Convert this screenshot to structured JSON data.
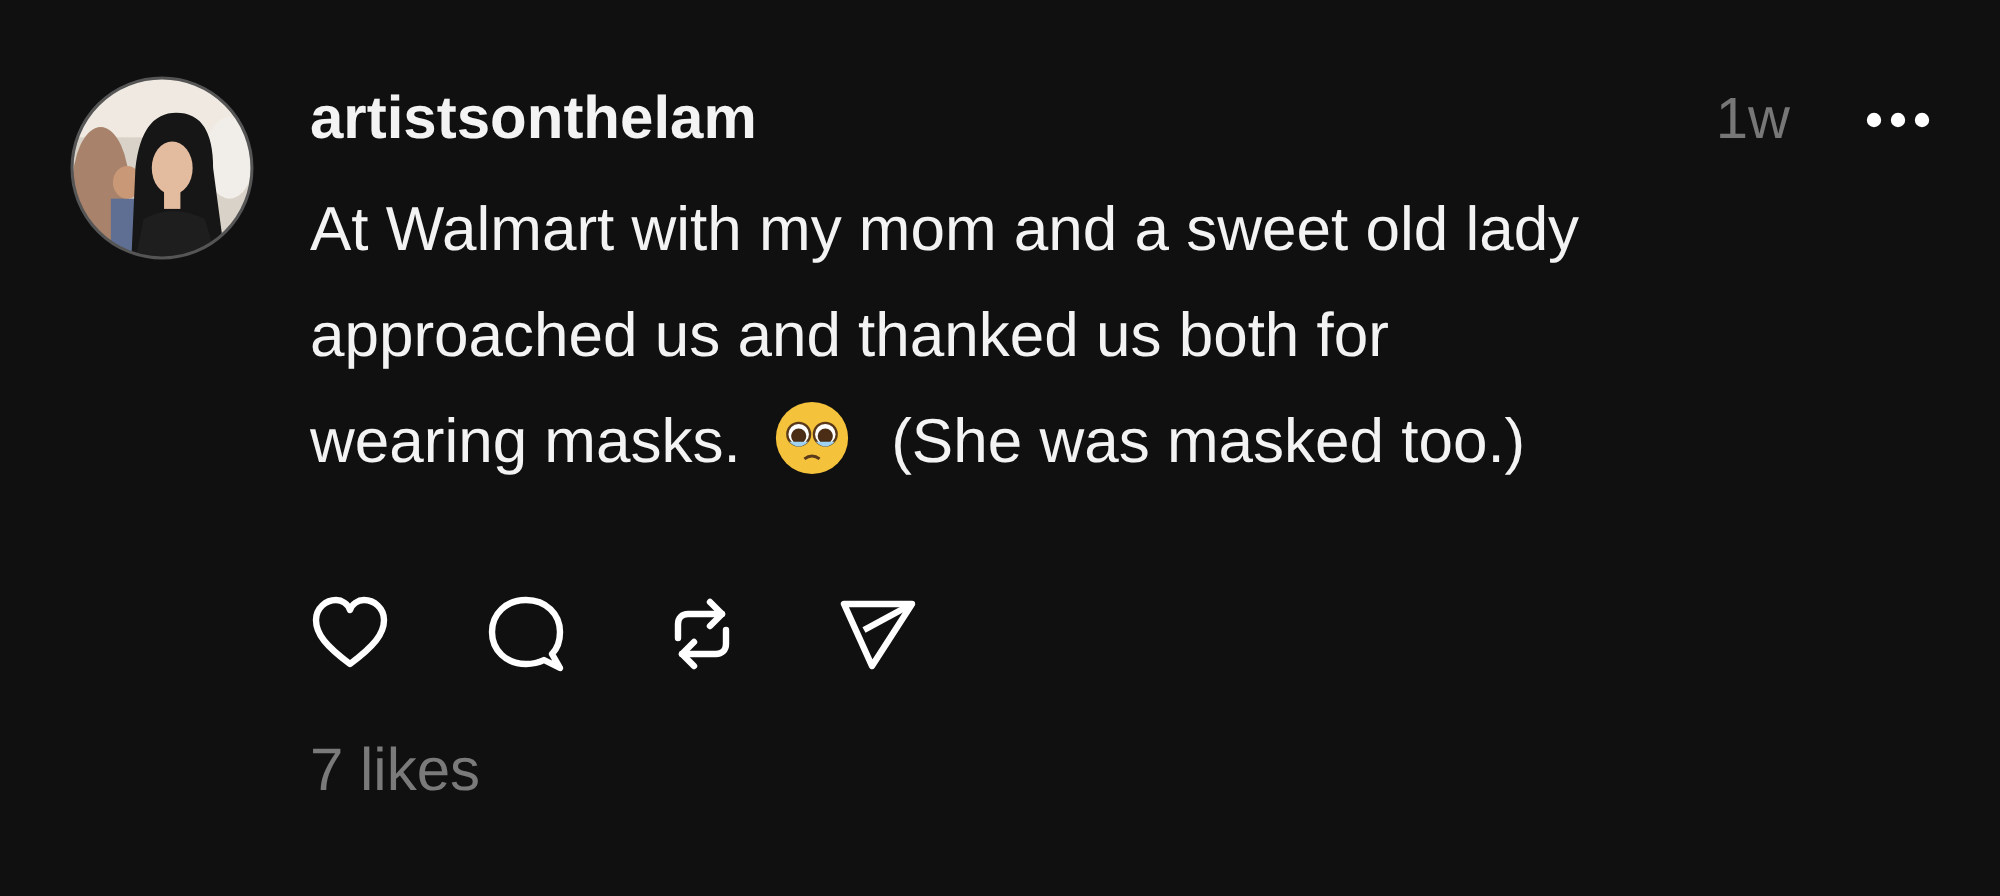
{
  "post": {
    "username": "artistsonthelam",
    "time": "1w",
    "text_lines": [
      "At Walmart with my mom and a sweet old lady",
      "approached us and thanked us both for"
    ],
    "last_line_before": "wearing masks.",
    "last_line_after": "(She was masked too.)",
    "likes": "7 likes"
  }
}
